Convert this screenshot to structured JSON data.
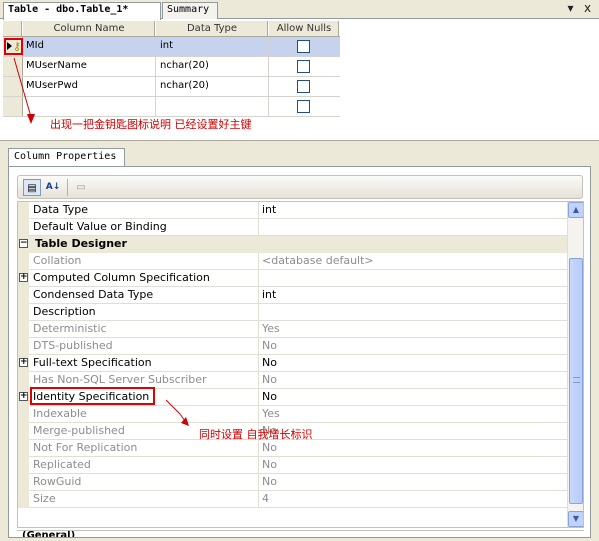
{
  "tabs": {
    "active": "Table - dbo.Table_1*",
    "summary": "Summary"
  },
  "window_buttons": {
    "dropdown": "▾",
    "close": "x"
  },
  "columns_grid": {
    "headers": [
      "Column Name",
      "Data Type",
      "Allow Nulls"
    ],
    "rows": [
      {
        "name": "MId",
        "type": "int",
        "allow_nulls": false,
        "primary_key": true
      },
      {
        "name": "MUserName",
        "type": "nchar(20)",
        "allow_nulls": false
      },
      {
        "name": "MUserPwd",
        "type": "nchar(20)",
        "allow_nulls": false
      },
      {
        "name": "",
        "type": "",
        "allow_nulls": false
      }
    ]
  },
  "annotations": {
    "primary_key_note": "出现一把金钥匙图标说明  已经设置好主键",
    "identity_note": "同时设置  自我增长标识",
    "color": "#d00000"
  },
  "column_properties": {
    "tab_label": "Column Properties",
    "toolbar": {
      "categorized": "▤",
      "alphabetical": "A↓",
      "property_pages": "▭"
    },
    "rows": [
      {
        "name": "Data Type",
        "value": "int",
        "readonly": false,
        "expander": ""
      },
      {
        "name": "Default Value or Binding",
        "value": "",
        "readonly": false,
        "expander": ""
      },
      {
        "name": "Table Designer",
        "value": "",
        "category": true,
        "expander": "−"
      },
      {
        "name": "Collation",
        "value": "<database default>",
        "readonly": true,
        "expander": ""
      },
      {
        "name": "Computed Column Specification",
        "value": "",
        "readonly": false,
        "expander": "+"
      },
      {
        "name": "Condensed Data Type",
        "value": "int",
        "readonly": false,
        "expander": ""
      },
      {
        "name": "Description",
        "value": "",
        "readonly": false,
        "expander": ""
      },
      {
        "name": "Deterministic",
        "value": "Yes",
        "readonly": true,
        "expander": ""
      },
      {
        "name": "DTS-published",
        "value": "No",
        "readonly": true,
        "expander": ""
      },
      {
        "name": "Full-text Specification",
        "value": "No",
        "readonly": false,
        "expander": "+"
      },
      {
        "name": "Has Non-SQL Server Subscriber",
        "value": "No",
        "readonly": true,
        "expander": ""
      },
      {
        "name": "Identity Specification",
        "value": "No",
        "readonly": false,
        "expander": "+"
      },
      {
        "name": "Indexable",
        "value": "Yes",
        "readonly": true,
        "expander": ""
      },
      {
        "name": "Merge-published",
        "value": "No",
        "readonly": true,
        "expander": ""
      },
      {
        "name": "Not For Replication",
        "value": "No",
        "readonly": true,
        "expander": ""
      },
      {
        "name": "Replicated",
        "value": "No",
        "readonly": true,
        "expander": ""
      },
      {
        "name": "RowGuid",
        "value": "No",
        "readonly": true,
        "expander": ""
      },
      {
        "name": "Size",
        "value": "4",
        "readonly": true,
        "expander": ""
      }
    ],
    "footer_category": "(General)",
    "scroll": {
      "up": "▲",
      "down": "▼",
      "grip": "≡"
    }
  }
}
